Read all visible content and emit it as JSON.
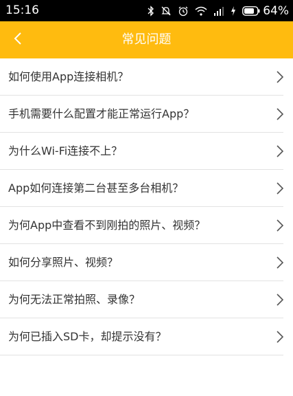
{
  "status_bar": {
    "time": "15:16",
    "battery_percent": "64%",
    "icons": [
      "bluetooth-icon",
      "mute-icon",
      "alarm-icon",
      "wifi-icon",
      "signal-icon",
      "charging-icon",
      "battery-icon"
    ]
  },
  "header": {
    "title": "常见问题",
    "back_icon": "chevron-left-icon",
    "background_color": "#ffbb0f"
  },
  "faq": {
    "items": [
      {
        "label": "如何使用App连接相机？"
      },
      {
        "label": "手机需要什么配置才能正常运行App？"
      },
      {
        "label": "为什么Wi-Fi连接不上？"
      },
      {
        "label": "App如何连接第二台甚至多台相机？"
      },
      {
        "label": "为何App中查看不到刚拍的照片、视频？"
      },
      {
        "label": "如何分享照片、视频？"
      },
      {
        "label": "为何无法正常拍照、录像？"
      },
      {
        "label": "为何已插入SD卡，却提示没有？"
      }
    ],
    "item_icon": "chevron-right-icon"
  }
}
